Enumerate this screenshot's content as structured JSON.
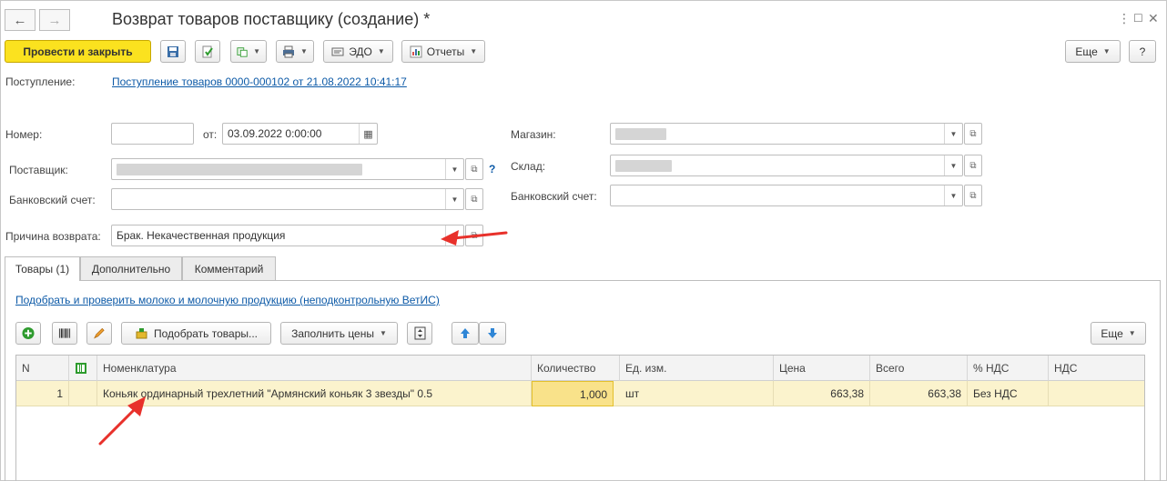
{
  "window": {
    "title": "Возврат товаров поставщику (создание) *"
  },
  "toolbar": {
    "post_close": "Провести и закрыть",
    "edo": "ЭДО",
    "reports": "Отчеты",
    "more": "Еще",
    "help": "?"
  },
  "receipt": {
    "label": "Поступление:",
    "link": "Поступление товаров 0000-000102 от 21.08.2022 10:41:17"
  },
  "form": {
    "number_label": "Номер:",
    "number_value": "",
    "date_label": "от:",
    "date_value": "03.09.2022  0:00:00",
    "supplier_label": "Поставщик:",
    "supplier_help": "?",
    "bank_label": "Банковский счет:",
    "bank_value": "",
    "reason_label": "Причина возврата:",
    "reason_value": "Брак. Некачественная продукция",
    "store_label": "Магазин:",
    "warehouse_label": "Склад:",
    "bank2_label": "Банковский счет:",
    "bank2_value": ""
  },
  "tabs": [
    {
      "label": "Товары (1)"
    },
    {
      "label": "Дополнительно"
    },
    {
      "label": "Комментарий"
    }
  ],
  "goods": {
    "vetis_link": "Подобрать и проверить молоко и молочную продукцию (неподконтрольную ВетИС)",
    "pick_goods": "Подобрать товары...",
    "fill_prices": "Заполнить цены",
    "more": "Еще",
    "columns": [
      "N",
      "",
      "Номенклатура",
      "Количество",
      "Ед. изм.",
      "Цена",
      "Всего",
      "% НДС",
      "НДС"
    ],
    "rows": [
      {
        "n": "1",
        "name": "Коньяк ординарный трехлетний \"Армянский коньяк 3 звезды\" 0.5",
        "qty": "1,000",
        "unit": "шт",
        "price": "663,38",
        "total": "663,38",
        "vat_rate": "Без НДС",
        "vat": ""
      }
    ]
  },
  "colors": {
    "primary_button": "#fbe21f",
    "selected_row": "#fbf3cd",
    "link": "#0d5aa7",
    "annotation_arrow": "#e8312b"
  }
}
